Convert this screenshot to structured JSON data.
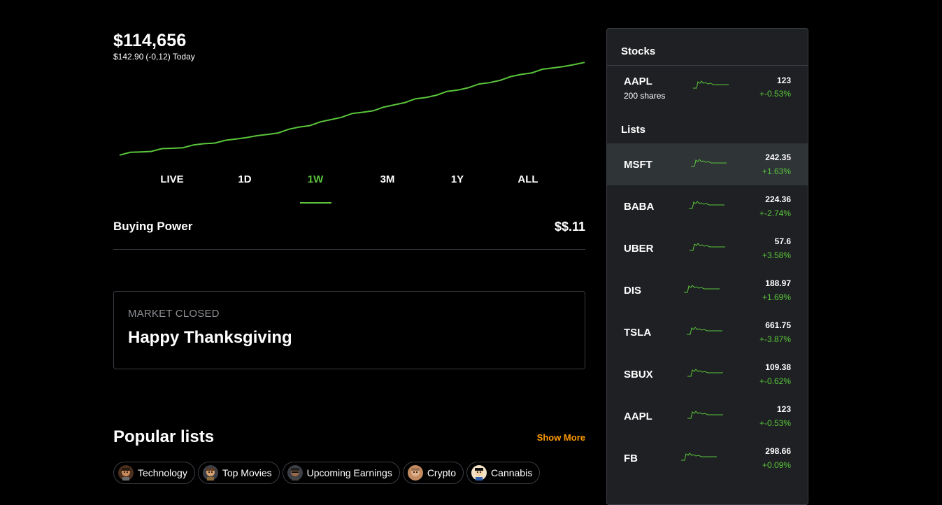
{
  "portfolio": {
    "value": "$114,656",
    "change_amount": "$142.90",
    "change_pct": "(-0,12)",
    "change_period": "Today"
  },
  "colors": {
    "accent": "#5ac53b",
    "show_more": "#ff9a00",
    "background": "#000000",
    "panel": "#1e2023"
  },
  "chart_data": {
    "type": "line",
    "title": "",
    "xlabel": "",
    "ylabel": "",
    "grid": false,
    "series": [
      {
        "values": [
          0,
          2,
          3,
          4,
          6,
          7,
          8,
          10,
          12,
          13,
          15,
          17,
          19,
          20,
          22,
          24,
          27,
          30,
          32,
          35,
          38,
          41,
          44,
          46,
          48,
          51,
          54,
          57,
          60,
          62,
          65,
          68,
          70,
          73,
          76,
          78,
          81,
          84,
          87,
          89,
          92,
          94,
          96,
          97,
          100
        ]
      }
    ]
  },
  "ranges": {
    "tabs": [
      "LIVE",
      "1D",
      "1W",
      "3M",
      "1Y",
      "ALL"
    ],
    "active": "1W"
  },
  "buying_power": {
    "label": "Buying Power",
    "value": "$$.11"
  },
  "market": {
    "status": "MARKET CLOSED",
    "message": "Happy Thanksgiving"
  },
  "popular": {
    "title": "Popular lists",
    "show_more": "Show More",
    "chips": [
      {
        "label": "Technology",
        "icon": "avatar-technology-icon"
      },
      {
        "label": "Top Movies",
        "icon": "avatar-movies-icon"
      },
      {
        "label": "Upcoming Earnings",
        "icon": "avatar-earnings-icon"
      },
      {
        "label": "Crypto",
        "icon": "avatar-crypto-icon"
      },
      {
        "label": "Cannabis",
        "icon": "avatar-cannabis-icon"
      }
    ]
  },
  "sidebar": {
    "stocks_header": "Stocks",
    "lists_header": "Lists",
    "stocks": [
      {
        "symbol": "AAPL",
        "shares": "200 shares",
        "price": "123",
        "pct": "+-0.53%"
      }
    ],
    "lists": [
      {
        "symbol": "MSFT",
        "price": "242.35",
        "pct": "+1.63%"
      },
      {
        "symbol": "BABA",
        "price": "224.36",
        "pct": "+-2.74%"
      },
      {
        "symbol": "UBER",
        "price": "57.6",
        "pct": "+3.58%"
      },
      {
        "symbol": "DIS",
        "price": "188.97",
        "pct": "+1.69%"
      },
      {
        "symbol": "TSLA",
        "price": "661.75",
        "pct": "+-3.87%"
      },
      {
        "symbol": "SBUX",
        "price": "109.38",
        "pct": "+-0.62%"
      },
      {
        "symbol": "AAPL",
        "price": "123",
        "pct": "+-0.53%"
      },
      {
        "symbol": "FB",
        "price": "298.66",
        "pct": "+0.09%"
      }
    ]
  }
}
